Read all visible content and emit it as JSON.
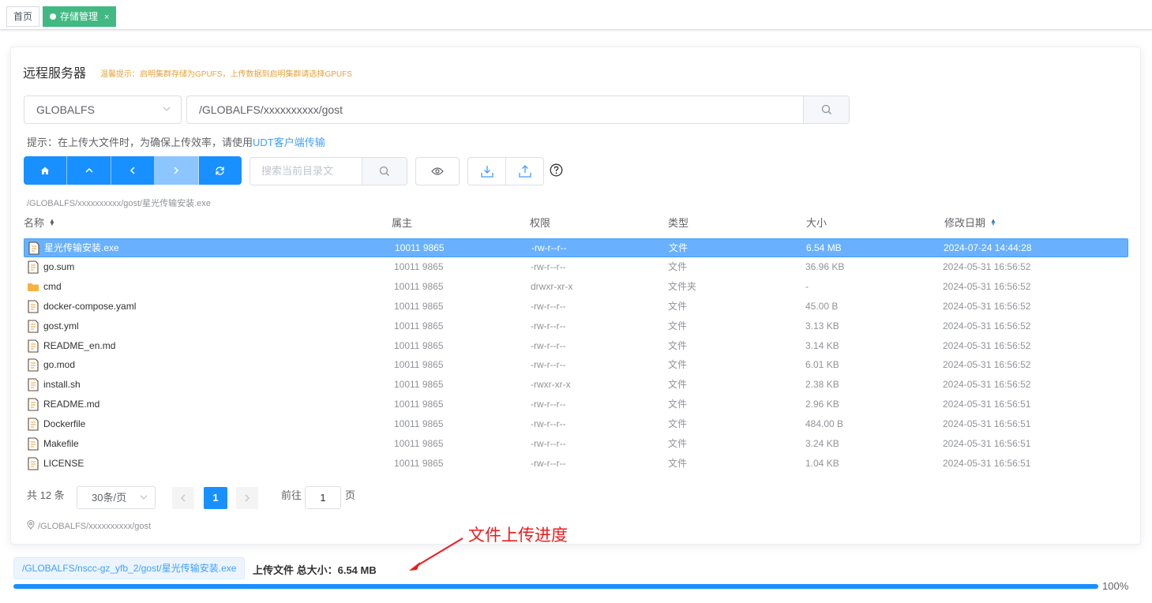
{
  "tabs": [
    {
      "label": "首页"
    },
    {
      "label": "存储管理",
      "close": "×"
    }
  ],
  "header": {
    "title": "远程服务器",
    "warning": "温馨提示：启明集群存储为GPUFS，上传数据到启明集群请选择GPUFS"
  },
  "storage_select": {
    "value": "GLOBALFS"
  },
  "path_input": {
    "value": "/GLOBALFS/xxxxxxxxxx/gost"
  },
  "hint": {
    "prefix": "提示：在上传大文件时，为确保上传效率，请使用",
    "link": "UDT客户端传输"
  },
  "toolbar": {
    "search_placeholder": "搜索当前目录文"
  },
  "current_file_path": "/GLOBALFS/xxxxxxxxxx/gost/星光传输安装.exe",
  "table": {
    "headers": {
      "name": "名称",
      "owner": "属主",
      "perm": "权限",
      "type": "类型",
      "size": "大小",
      "mtime": "修改日期"
    },
    "rows": [
      {
        "name": "星光传输安装.exe",
        "owner": "10011 9865",
        "perm": "-rw-r--r--",
        "type": "文件",
        "size": "6.54 MB",
        "mtime": "2024-07-24 14:44:28",
        "kind": "file",
        "selected": true
      },
      {
        "name": "go.sum",
        "owner": "10011 9865",
        "perm": "-rw-r--r--",
        "type": "文件",
        "size": "36.96 KB",
        "mtime": "2024-05-31 16:56:52",
        "kind": "file"
      },
      {
        "name": "cmd",
        "owner": "10011 9865",
        "perm": "drwxr-xr-x",
        "type": "文件夹",
        "size": "-",
        "mtime": "2024-05-31 16:56:52",
        "kind": "folder"
      },
      {
        "name": "docker-compose.yaml",
        "owner": "10011 9865",
        "perm": "-rw-r--r--",
        "type": "文件",
        "size": "45.00 B",
        "mtime": "2024-05-31 16:56:52",
        "kind": "file"
      },
      {
        "name": "gost.yml",
        "owner": "10011 9865",
        "perm": "-rw-r--r--",
        "type": "文件",
        "size": "3.13 KB",
        "mtime": "2024-05-31 16:56:52",
        "kind": "file"
      },
      {
        "name": "README_en.md",
        "owner": "10011 9865",
        "perm": "-rw-r--r--",
        "type": "文件",
        "size": "3.14 KB",
        "mtime": "2024-05-31 16:56:52",
        "kind": "file"
      },
      {
        "name": "go.mod",
        "owner": "10011 9865",
        "perm": "-rw-r--r--",
        "type": "文件",
        "size": "6.01 KB",
        "mtime": "2024-05-31 16:56:52",
        "kind": "file"
      },
      {
        "name": "install.sh",
        "owner": "10011 9865",
        "perm": "-rwxr-xr-x",
        "type": "文件",
        "size": "2.38 KB",
        "mtime": "2024-05-31 16:56:52",
        "kind": "file"
      },
      {
        "name": "README.md",
        "owner": "10011 9865",
        "perm": "-rw-r--r--",
        "type": "文件",
        "size": "2.96 KB",
        "mtime": "2024-05-31 16:56:51",
        "kind": "file"
      },
      {
        "name": "Dockerfile",
        "owner": "10011 9865",
        "perm": "-rw-r--r--",
        "type": "文件",
        "size": "484.00 B",
        "mtime": "2024-05-31 16:56:51",
        "kind": "file"
      },
      {
        "name": "Makefile",
        "owner": "10011 9865",
        "perm": "-rw-r--r--",
        "type": "文件",
        "size": "3.24 KB",
        "mtime": "2024-05-31 16:56:51",
        "kind": "file"
      },
      {
        "name": "LICENSE",
        "owner": "10011 9865",
        "perm": "-rw-r--r--",
        "type": "文件",
        "size": "1.04 KB",
        "mtime": "2024-05-31 16:56:51",
        "kind": "file"
      }
    ]
  },
  "pagination": {
    "total": "共 12 条",
    "page_size": "30条/页",
    "current": "1",
    "goto_prefix": "前往",
    "goto_value": "1",
    "goto_suffix": "页"
  },
  "location": "/GLOBALFS/xxxxxxxxxx/gost",
  "upload": {
    "file": "/GLOBALFS/nscc-gz_yfb_2/gost/星光传输安装.exe",
    "label": "上传文件  总大小：6.54 MB",
    "progress_percent": 100,
    "progress_text": "100%"
  },
  "annotation": {
    "text": "文件上传进度",
    "color": "#f01a1a"
  },
  "colors": {
    "primary": "#1890ff",
    "tab_active": "#42b983",
    "selected_row": "#69b1ff"
  }
}
